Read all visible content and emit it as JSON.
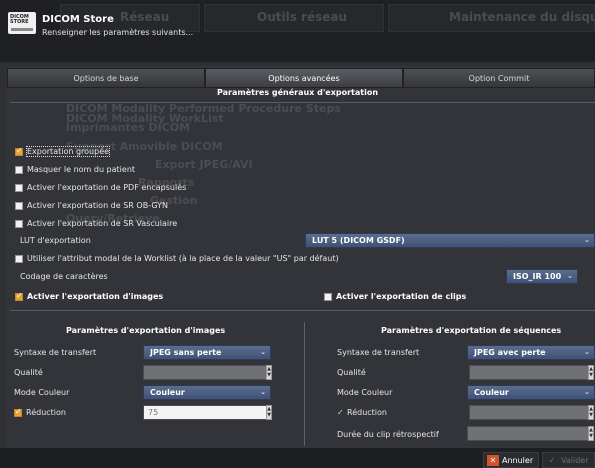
{
  "header": {
    "title": "DICOM Store",
    "subtitle": "Renseigner les paramètres suivants...",
    "icon_text": "DICOM STORE"
  },
  "background": {
    "tabs": [
      "Réseau",
      "Outils réseau",
      "Maintenance du disque"
    ],
    "ghost_items": [
      "DICOM Modality WorkList",
      "DICOM Modality Performed Procedure Steps",
      "Imprimantes DICOM",
      "Support Amovible DICOM",
      "Export JPEG/AVI",
      "Rapports",
      "Gestion",
      "Query/Retrieve"
    ]
  },
  "tabs": [
    {
      "label": "Options de base",
      "active": false
    },
    {
      "label": "Options avancées",
      "active": true
    },
    {
      "label": "Option Commit",
      "active": false
    }
  ],
  "section_title": "Paramètres généraux d'exportation",
  "options": [
    {
      "label": "Exportation groupée",
      "checked": true
    },
    {
      "label": "Masquer le nom du patient",
      "checked": false
    },
    {
      "label": "Activer l'exportation de PDF encapsulés",
      "checked": false
    },
    {
      "label": "Activer l'exportation de SR OB-GYN",
      "checked": false
    },
    {
      "label": "Activer l'exportation de SR Vasculaire",
      "checked": false
    }
  ],
  "lut": {
    "label": "LUT d'exportation",
    "value": "LUT 5 (DICOM GSDF)"
  },
  "worklist_modality": {
    "label": "Utiliser l'attribut modal de la Worklist (à la place de la valeur \"US\" par défaut)",
    "checked": false
  },
  "charset": {
    "label": "Codage de caractères",
    "value": "ISO_IR 100"
  },
  "image_export": {
    "label": "Activer l'exportation d'images",
    "checked": true
  },
  "clip_export": {
    "label": "Activer l'exportation de clips",
    "checked": false
  },
  "image_params": {
    "title": "Paramètres d'exportation d'images",
    "syntax_label": "Syntaxe de transfert",
    "syntax_value": "JPEG sans perte",
    "quality_label": "Qualité",
    "quality_value": "",
    "color_label": "Mode Couleur",
    "color_value": "Couleur",
    "reduction_label": "Réduction",
    "reduction_checked": true,
    "reduction_value": "75"
  },
  "clip_params": {
    "title": "Paramètres d'exportation de séquences",
    "syntax_label": "Syntaxe de transfert",
    "syntax_value": "JPEG avec perte",
    "quality_label": "Qualité",
    "color_label": "Mode Couleur",
    "color_value": "Couleur",
    "reduction_label": "Réduction",
    "reduction_checked": true,
    "duration_label": "Durée du clip rétrospectif"
  },
  "footer": {
    "cancel_label": "Annuler",
    "validate_label": "Valider"
  },
  "colors": {
    "accent_orange": "#e4a43a",
    "combo_blue": "#4a5d82",
    "cancel_red": "#d0532a"
  }
}
